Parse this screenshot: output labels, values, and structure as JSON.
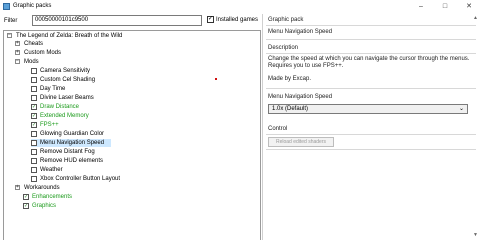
{
  "window": {
    "title": "Graphic packs",
    "minimize": "–",
    "maximize": "□",
    "close": "✕"
  },
  "filter": {
    "label": "Filter",
    "value": "00050000101c9500",
    "installed_label": "Installed games",
    "installed_checked": true
  },
  "tree": {
    "root": "The Legend of Zelda: Breath of the Wild",
    "cheats": "Cheats",
    "custom_mods": "Custom Mods",
    "mods": "Mods",
    "mods_items": [
      {
        "label": "Camera Sensitivity",
        "checked": false,
        "green": false
      },
      {
        "label": "Custom Cel Shading",
        "checked": false,
        "green": false
      },
      {
        "label": "Day Time",
        "checked": false,
        "green": false
      },
      {
        "label": "Divine Laser Beams",
        "checked": false,
        "green": false
      },
      {
        "label": "Draw Distance",
        "checked": true,
        "green": true
      },
      {
        "label": "Extended Memory",
        "checked": true,
        "green": true
      },
      {
        "label": "FPS++",
        "checked": true,
        "green": true
      },
      {
        "label": "Glowing Guardian Color",
        "checked": false,
        "green": false
      },
      {
        "label": "Menu Navigation Speed",
        "checked": false,
        "green": false
      },
      {
        "label": "Remove Distant Fog",
        "checked": false,
        "green": false
      },
      {
        "label": "Remove HUD elements",
        "checked": false,
        "green": false
      },
      {
        "label": "Weather",
        "checked": false,
        "green": false
      },
      {
        "label": "Xbox Controller Button Layout",
        "checked": false,
        "green": false
      }
    ],
    "workarounds": "Workarounds",
    "enhancements": "Enhancements",
    "graphics": "Graphics"
  },
  "details": {
    "pack_heading": "Graphic pack",
    "pack_name": "Menu Navigation Speed",
    "desc_heading": "Description",
    "desc_line1": "Change the speed at which you can navigate the cursor through the menus.",
    "desc_line2": "Requires you to use FPS++.",
    "made_by": "Made by Excap.",
    "preset_heading": "Menu Navigation Speed",
    "preset_value": "1.0x (Default)",
    "control_heading": "Control",
    "reload_label": "Reload edited shaders"
  }
}
